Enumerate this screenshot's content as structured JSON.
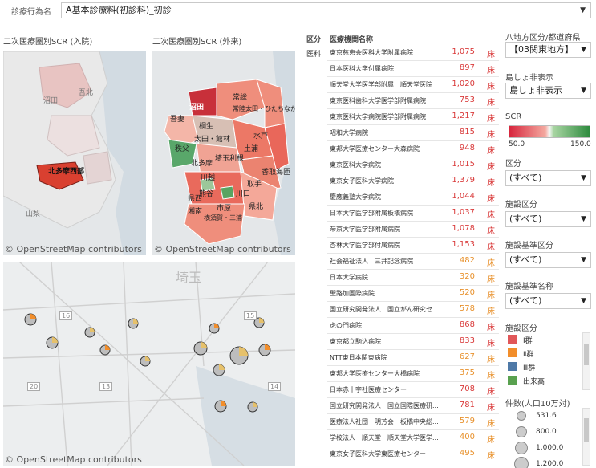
{
  "top": {
    "label": "診療行為名",
    "value": "A基本診療料(初診料)_初診"
  },
  "maps": {
    "inpatient_title": "二次医療圏別SCR (入院)",
    "outpatient_title": "二次医療圏別SCR (外来)",
    "credit": "© OpenStreetMap contributors",
    "inpatient_regions": [
      "沼田",
      "吾北",
      "山梨",
      "北多摩西部"
    ],
    "inpatient_highlight": "北多摩西部",
    "outpatient_regions": [
      "沼田",
      "吾妻",
      "常総",
      "桐生",
      "太田・館林",
      "常陸太田・ひたちなか",
      "秩父",
      "埼玉利根",
      "水戸",
      "北多摩",
      "土浦",
      "香取海匝",
      "取手",
      "川越",
      "川口",
      "県西",
      "市原",
      "横須賀・三浦",
      "湘南",
      "県北",
      "熊谷"
    ],
    "large_map_labels": [
      "埼玉",
      "16",
      "15",
      "20",
      "13",
      "14"
    ]
  },
  "table": {
    "col_kubun": "区分",
    "col_name": "医療機関名称",
    "kubun_value": "医科",
    "unit": "床",
    "rows": [
      {
        "name": "東京慈恵会医科大学附属病院",
        "value": "1,075"
      },
      {
        "name": "日本医科大学付属病院",
        "value": "897"
      },
      {
        "name": "順天堂大学医学部附属　順天堂医院",
        "value": "1,020"
      },
      {
        "name": "東京医科歯科大学医学部附属病院",
        "value": "753"
      },
      {
        "name": "東京医科大学病院医学部附属病院",
        "value": "1,217"
      },
      {
        "name": "昭和大学病院",
        "value": "815"
      },
      {
        "name": "東邦大学医療センター大森病院",
        "value": "948"
      },
      {
        "name": "東京医科大学病院",
        "value": "1,015"
      },
      {
        "name": "東京女子医科大学病院",
        "value": "1,379"
      },
      {
        "name": "慶應義塾大学病院",
        "value": "1,044"
      },
      {
        "name": "日本大学医学部附属板橋病院",
        "value": "1,037"
      },
      {
        "name": "帝京大学医学部附属病院",
        "value": "1,078"
      },
      {
        "name": "杏林大学医学部付属病院",
        "value": "1,153"
      },
      {
        "name": "社会福祉法人　三井記念病院",
        "value": "482"
      },
      {
        "name": "日本大学病院",
        "value": "320"
      },
      {
        "name": "聖路加国際病院",
        "value": "520"
      },
      {
        "name": "国立研究開発法人　国立がん研究セ...",
        "value": "578"
      },
      {
        "name": "虎の門病院",
        "value": "868"
      },
      {
        "name": "東京都立駒込病院",
        "value": "833"
      },
      {
        "name": "NTT東日本関東病院",
        "value": "627"
      },
      {
        "name": "東邦大学医療センター大橋病院",
        "value": "375"
      },
      {
        "name": "日本赤十字社医療センター",
        "value": "708"
      },
      {
        "name": "国立研究開発法人　国立国際医療研...",
        "value": "781"
      },
      {
        "name": "医療法人社団　明芳会　板橋中央総...",
        "value": "579"
      },
      {
        "name": "学校法人　順天堂　順天堂大学医学...",
        "value": "400"
      },
      {
        "name": "東京女子医科大学東医療センター",
        "value": "495"
      }
    ]
  },
  "filters": {
    "region_label": "八地方区分/都道府県",
    "region_value": "【03関東地方】",
    "island_label": "島しょ非表示",
    "island_value": "島しょ非表示",
    "scr_label": "SCR",
    "scr_min": "50.0",
    "scr_max": "150.0",
    "kubun_label": "区分",
    "kubun_value": "(すべて)",
    "shisetsu_label": "施設区分",
    "shisetsu_value": "(すべて)",
    "kijun_kubun_label": "施設基準区分",
    "kijun_kubun_value": "(すべて)",
    "kijun_name_label": "施設基準名称",
    "kijun_name_value": "(すべて)"
  },
  "legend": {
    "title": "施設区分",
    "items": [
      {
        "label": "Ⅰ群",
        "color": "#e15759"
      },
      {
        "label": "Ⅱ群",
        "color": "#f28e2b"
      },
      {
        "label": "Ⅲ群",
        "color": "#4e79a7"
      },
      {
        "label": "出来高",
        "color": "#59a14f"
      }
    ]
  },
  "size_legend": {
    "title": "件数(人口10万対)",
    "items": [
      "531.6",
      "800.0",
      "1,000.0",
      "1,200.0"
    ]
  }
}
